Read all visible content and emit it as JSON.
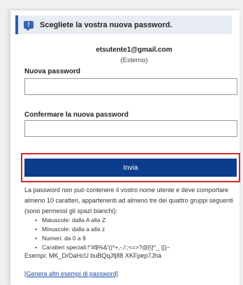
{
  "banner": {
    "icon": "info-flag-icon",
    "text": "Scegliete la vostra nuova password."
  },
  "account": {
    "email": "etsutente1@gmail.com",
    "type": "(Esterno)"
  },
  "form": {
    "new_password_label": "Nuova password",
    "new_password_value": "",
    "confirm_password_label": "Confermare la nuova password",
    "confirm_password_value": "",
    "submit_label": "Invia"
  },
  "rules": {
    "intro": "La password non può contenere il vostro nome utente e deve comportare almeno 10 caratteri, appartenenti ad almeno tre dei quattro gruppi seguenti (sono permessi gli spazi bianchi):",
    "items": [
      "Maiuscole: dalla A alla Z",
      "Minuscole: dalla a alla z",
      "Numeri: da 0 a 9",
      "Caratteri speciali:!\"#$%&'()*+,-./:;<=>?@[\\]^_`{|}~"
    ],
    "examples": "Esempi: MK_DrDaHcU buBQqJfj88 XKFpep7Jha",
    "generate_link": "[Genera altri esempi di password]"
  },
  "colors": {
    "accent": "#0c3d8d",
    "highlight": "#d7262c",
    "banner_bg": "#e7ecf3"
  }
}
